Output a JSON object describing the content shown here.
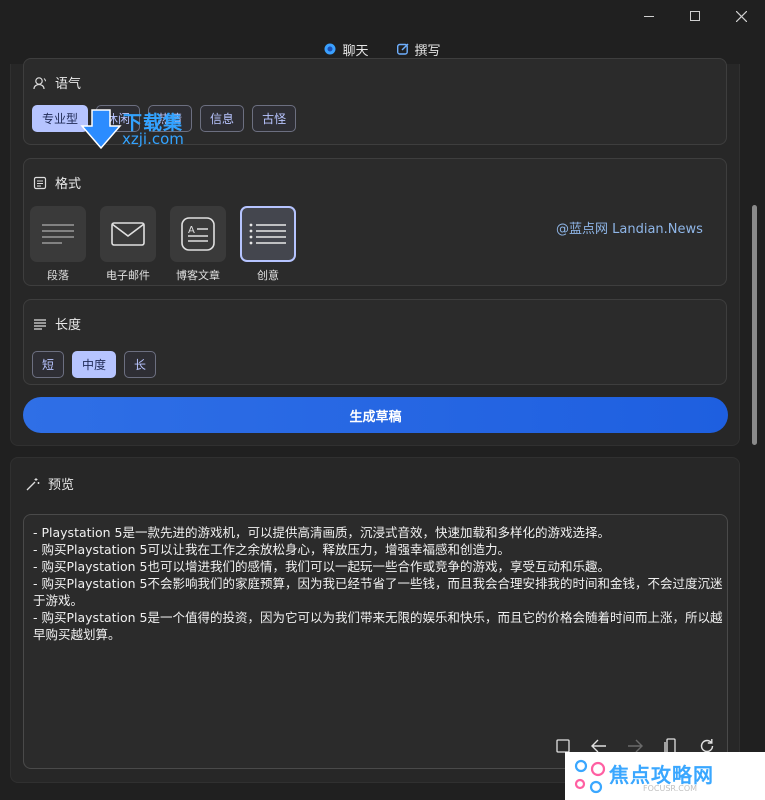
{
  "tabs": [
    {
      "label": "聊天",
      "icon": "chat-icon",
      "active": false
    },
    {
      "label": "撰写",
      "icon": "compose-icon",
      "active": true
    }
  ],
  "tone": {
    "title": "语气",
    "icon": "tone-icon",
    "options": [
      {
        "label": "专业型",
        "selected": true
      },
      {
        "label": "休闲",
        "selected": false
      },
      {
        "label": "热情",
        "selected": false
      },
      {
        "label": "信息",
        "selected": false
      },
      {
        "label": "古怪",
        "selected": false
      }
    ]
  },
  "format": {
    "title": "格式",
    "icon": "format-icon",
    "options": [
      {
        "label": "段落",
        "icon": "paragraph-icon",
        "selected": false
      },
      {
        "label": "电子邮件",
        "icon": "email-icon",
        "selected": false
      },
      {
        "label": "博客文章",
        "icon": "blog-icon",
        "selected": false
      },
      {
        "label": "创意",
        "icon": "list-icon",
        "selected": true
      }
    ]
  },
  "length": {
    "title": "长度",
    "icon": "length-icon",
    "options": [
      {
        "label": "短",
        "selected": false
      },
      {
        "label": "中度",
        "selected": true
      },
      {
        "label": "长",
        "selected": false
      }
    ]
  },
  "generate_label": "生成草稿",
  "watermark": "@蓝点网 Landian.News",
  "preview": {
    "title": "预览",
    "icon": "magic-wand-icon",
    "lines": [
      "- Playstation 5是一款先进的游戏机，可以提供高清画质，沉浸式音效，快速加载和多样化的游戏选择。",
      "- 购买Playstation 5可以让我在工作之余放松身心，释放压力，增强幸福感和创造力。",
      "- 购买Playstation 5也可以增进我们的感情，我们可以一起玩一些合作或竞争的游戏，享受互动和乐趣。",
      "- 购买Playstation 5不会影响我们的家庭预算，因为我已经节省了一些钱，而且我会合理安排我的时间和金钱，不会过度沉迷于游戏。",
      "- 购买Playstation 5是一个值得的投资，因为它可以为我们带来无限的娱乐和快乐，而且它的价格会随着时间而上涨，所以越早购买越划算。"
    ]
  },
  "logos": {
    "xzji_cn": "下载集",
    "xzji_url": "xzji.com",
    "jd_cn": "焦点攻略网",
    "jd_url": "FOCUSR.COM"
  }
}
